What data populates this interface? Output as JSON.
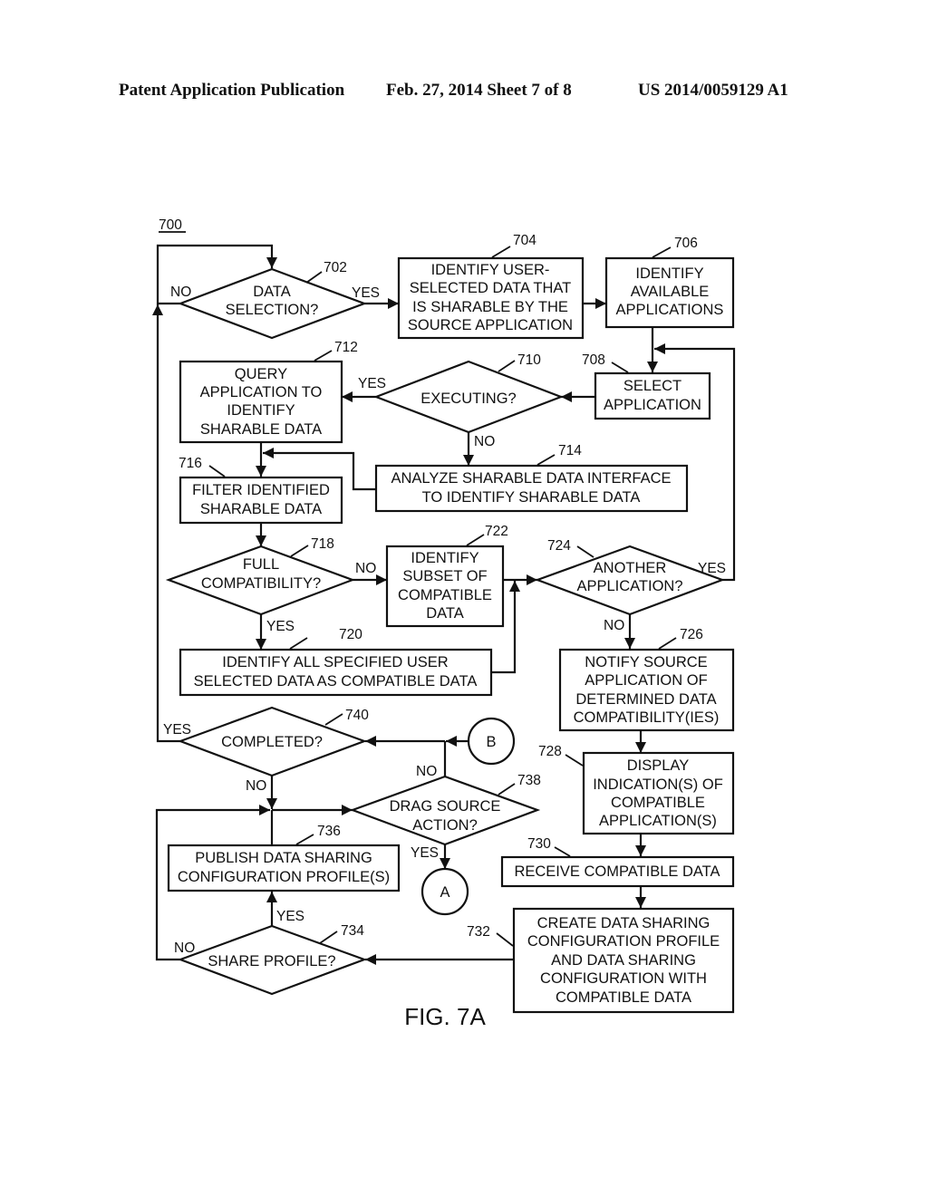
{
  "header": {
    "left": "Patent Application Publication",
    "middle": "Feb. 27, 2014   Sheet 7 of 8",
    "right": "US 2014/0059129 A1"
  },
  "figure": {
    "ref": "700",
    "caption": "FIG. 7A"
  },
  "nodes": {
    "n702": {
      "ref": "702",
      "type": "decision",
      "lines": [
        "DATA",
        "SELECTION?"
      ]
    },
    "n704": {
      "ref": "704",
      "type": "process",
      "lines": [
        "IDENTIFY USER-",
        "SELECTED DATA THAT",
        "IS SHARABLE BY THE",
        "SOURCE APPLICATION"
      ]
    },
    "n706": {
      "ref": "706",
      "type": "process",
      "lines": [
        "IDENTIFY",
        "AVAILABLE",
        "APPLICATIONS"
      ]
    },
    "n708": {
      "ref": "708",
      "type": "process",
      "lines": [
        "SELECT",
        "APPLICATION"
      ]
    },
    "n710": {
      "ref": "710",
      "type": "decision",
      "lines": [
        "EXECUTING?"
      ]
    },
    "n712": {
      "ref": "712",
      "type": "process",
      "lines": [
        "QUERY",
        "APPLICATION TO",
        "IDENTIFY",
        "SHARABLE DATA"
      ]
    },
    "n714": {
      "ref": "714",
      "type": "process",
      "lines": [
        "ANALYZE SHARABLE DATA INTERFACE",
        "TO IDENTIFY SHARABLE DATA"
      ]
    },
    "n716": {
      "ref": "716",
      "type": "process",
      "lines": [
        "FILTER IDENTIFIED",
        "SHARABLE DATA"
      ]
    },
    "n718": {
      "ref": "718",
      "type": "decision",
      "lines": [
        "FULL",
        "COMPATIBILITY?"
      ]
    },
    "n720": {
      "ref": "720",
      "type": "process",
      "lines": [
        "IDENTIFY ALL SPECIFIED USER",
        "SELECTED DATA AS COMPATIBLE DATA"
      ]
    },
    "n722": {
      "ref": "722",
      "type": "process",
      "lines": [
        "IDENTIFY",
        "SUBSET OF",
        "COMPATIBLE",
        "DATA"
      ]
    },
    "n724": {
      "ref": "724",
      "type": "decision",
      "lines": [
        "ANOTHER",
        "APPLICATION?"
      ]
    },
    "n726": {
      "ref": "726",
      "type": "process",
      "lines": [
        "NOTIFY SOURCE",
        "APPLICATION OF",
        "DETERMINED DATA",
        "COMPATIBILITY(IES)"
      ]
    },
    "n728": {
      "ref": "728",
      "type": "process",
      "lines": [
        "DISPLAY",
        "INDICATION(S) OF",
        "COMPATIBLE",
        "APPLICATION(S)"
      ]
    },
    "n730": {
      "ref": "730",
      "type": "process",
      "lines": [
        "RECEIVE COMPATIBLE DATA"
      ]
    },
    "n732": {
      "ref": "732",
      "type": "process",
      "lines": [
        "CREATE DATA SHARING",
        "CONFIGURATION PROFILE",
        "AND DATA SHARING",
        "CONFIGURATION WITH",
        "COMPATIBLE DATA"
      ]
    },
    "n734": {
      "ref": "734",
      "type": "decision",
      "lines": [
        "SHARE PROFILE?"
      ]
    },
    "n736": {
      "ref": "736",
      "type": "process",
      "lines": [
        "PUBLISH DATA SHARING",
        "CONFIGURATION PROFILE(S)"
      ]
    },
    "n738": {
      "ref": "738",
      "type": "decision",
      "lines": [
        "DRAG SOURCE",
        "ACTION?"
      ]
    },
    "n740": {
      "ref": "740",
      "type": "decision",
      "lines": [
        "COMPLETED?"
      ]
    },
    "connA": {
      "type": "connector",
      "label": "A"
    },
    "connB": {
      "type": "connector",
      "label": "B"
    }
  },
  "edges": [
    {
      "from": "702",
      "to": "702",
      "label": "NO"
    },
    {
      "from": "702",
      "to": "704",
      "label": "YES"
    },
    {
      "from": "704",
      "to": "706",
      "label": ""
    },
    {
      "from": "706",
      "to": "708",
      "label": ""
    },
    {
      "from": "708",
      "to": "710",
      "label": ""
    },
    {
      "from": "710",
      "to": "712",
      "label": "YES"
    },
    {
      "from": "710",
      "to": "714",
      "label": "NO"
    },
    {
      "from": "712",
      "to": "716",
      "label": ""
    },
    {
      "from": "714",
      "to": "716",
      "label": ""
    },
    {
      "from": "716",
      "to": "718",
      "label": ""
    },
    {
      "from": "718",
      "to": "722",
      "label": "NO"
    },
    {
      "from": "718",
      "to": "720",
      "label": "YES"
    },
    {
      "from": "722",
      "to": "724",
      "label": ""
    },
    {
      "from": "720",
      "to": "724",
      "label": ""
    },
    {
      "from": "724",
      "to": "708",
      "label": "YES"
    },
    {
      "from": "724",
      "to": "726",
      "label": "NO"
    },
    {
      "from": "726",
      "to": "728",
      "label": ""
    },
    {
      "from": "728",
      "to": "730",
      "label": ""
    },
    {
      "from": "730",
      "to": "732",
      "label": ""
    },
    {
      "from": "732",
      "to": "734",
      "label": ""
    },
    {
      "from": "734",
      "to": "736",
      "label": "YES"
    },
    {
      "from": "734",
      "to": "738",
      "label": "NO"
    },
    {
      "from": "736",
      "to": "738",
      "label": ""
    },
    {
      "from": "738",
      "to": "A",
      "label": "YES"
    },
    {
      "from": "738",
      "to": "740",
      "label": "NO"
    },
    {
      "from": "B",
      "to": "740",
      "label": ""
    },
    {
      "from": "740",
      "to": "702",
      "label": "YES"
    },
    {
      "from": "740",
      "to": "738",
      "label": "NO"
    }
  ]
}
